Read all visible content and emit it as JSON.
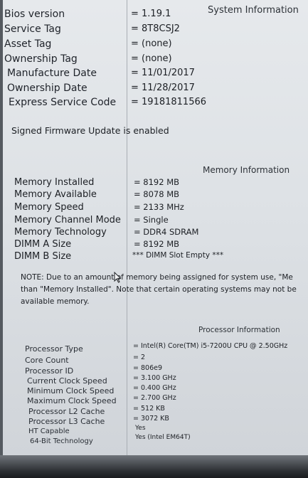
{
  "system": {
    "title": "System Information",
    "rows": [
      {
        "label": "Bios version",
        "value": "= 1.19.1"
      },
      {
        "label": "Service Tag",
        "value": "= 8T8CSJ2"
      },
      {
        "label": "Asset Tag",
        "value": "= (none)"
      },
      {
        "label": "Ownership Tag",
        "value": "= (none)"
      },
      {
        "label": "Manufacture Date",
        "value": "= 11/01/2017"
      },
      {
        "label": "Ownership Date",
        "value": "= 11/28/2017"
      },
      {
        "label": "Express Service Code",
        "value": "= 19181811566"
      }
    ],
    "firmware_message": "Signed Firmware Update is enabled"
  },
  "memory": {
    "title": "Memory Information",
    "rows": [
      {
        "label": "Memory Installed",
        "value": "= 8192 MB"
      },
      {
        "label": "Memory Available",
        "value": "= 8078 MB"
      },
      {
        "label": "Memory Speed",
        "value": "= 2133 MHz"
      },
      {
        "label": "Memory Channel Mode",
        "value": "= Single"
      },
      {
        "label": "Memory Technology",
        "value": "= DDR4 SDRAM"
      },
      {
        "label": "DIMM A Size",
        "value": "= 8192 MB"
      },
      {
        "label": "DIMM B Size",
        "value": "*** DIMM Slot Empty ***"
      }
    ],
    "note_lines": [
      "NOTE: Due to an amount of memory being assigned for system use, \"Me",
      "than \"Memory Installed\". Note that certain operating systems may not be",
      "available memory."
    ]
  },
  "processor": {
    "title": "Processor Information",
    "rows": [
      {
        "label": "Processor Type",
        "value": "= Intel(R) Core(TM) i5-7200U CPU @ 2.50GHz"
      },
      {
        "label": "Core Count",
        "value": "= 2"
      },
      {
        "label": "Processor ID",
        "value": "= 806e9"
      },
      {
        "label": "Current Clock Speed",
        "value": "= 3.100 GHz"
      },
      {
        "label": "Minimum Clock Speed",
        "value": "= 0.400 GHz"
      },
      {
        "label": "Maximum Clock Speed",
        "value": "= 2.700 GHz"
      },
      {
        "label": "Processor L2 Cache",
        "value": "= 512 KB"
      },
      {
        "label": "Processor L3 Cache",
        "value": "= 3072 KB"
      },
      {
        "label": "HT Capable",
        "value": "Yes"
      },
      {
        "label": "64-Bit Technology",
        "value": "Yes (Intel EM64T)"
      }
    ]
  }
}
